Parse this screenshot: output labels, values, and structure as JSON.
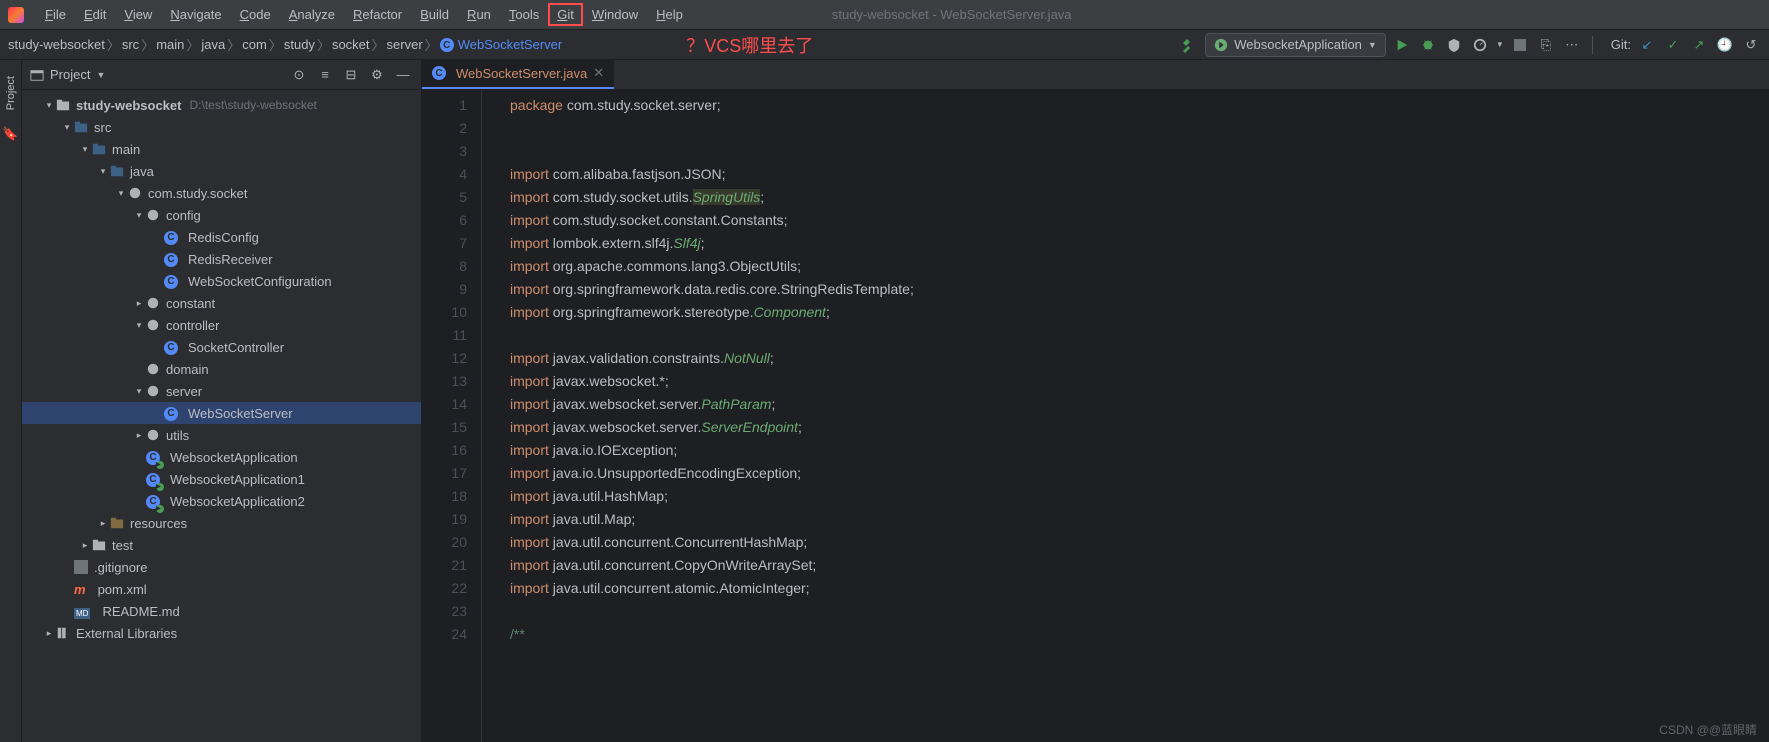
{
  "window": {
    "title": "study-websocket - WebSocketServer.java"
  },
  "menu": {
    "items": [
      "File",
      "Edit",
      "View",
      "Navigate",
      "Code",
      "Analyze",
      "Refactor",
      "Build",
      "Run",
      "Tools",
      "Git",
      "Window",
      "Help"
    ],
    "highlighted_index": 10
  },
  "annotation": "？VCS哪里去了",
  "breadcrumb": {
    "segments": [
      "study-websocket",
      "src",
      "main",
      "java",
      "com",
      "study",
      "socket",
      "server"
    ],
    "current_class": "WebSocketServer"
  },
  "run_config": {
    "name": "WebsocketApplication"
  },
  "git_label": "Git:",
  "project_panel": {
    "title": "Project",
    "root": {
      "label": "study-websocket",
      "path": "D:\\test\\study-websocket"
    },
    "tree": [
      {
        "depth": 0,
        "arrow": "▾",
        "icon": "project",
        "label": "study-websocket",
        "bold": true,
        "path": "D:\\test\\study-websocket"
      },
      {
        "depth": 1,
        "arrow": "▾",
        "icon": "folder-src",
        "label": "src"
      },
      {
        "depth": 2,
        "arrow": "▾",
        "icon": "folder-src",
        "label": "main"
      },
      {
        "depth": 3,
        "arrow": "▾",
        "icon": "folder-src",
        "label": "java"
      },
      {
        "depth": 4,
        "arrow": "▾",
        "icon": "package",
        "label": "com.study.socket"
      },
      {
        "depth": 5,
        "arrow": "▾",
        "icon": "package",
        "label": "config"
      },
      {
        "depth": 6,
        "arrow": "",
        "icon": "class",
        "label": "RedisConfig"
      },
      {
        "depth": 6,
        "arrow": "",
        "icon": "class",
        "label": "RedisReceiver"
      },
      {
        "depth": 6,
        "arrow": "",
        "icon": "class",
        "label": "WebSocketConfiguration"
      },
      {
        "depth": 5,
        "arrow": "▸",
        "icon": "package",
        "label": "constant"
      },
      {
        "depth": 5,
        "arrow": "▾",
        "icon": "package",
        "label": "controller"
      },
      {
        "depth": 6,
        "arrow": "",
        "icon": "class",
        "label": "SocketController"
      },
      {
        "depth": 5,
        "arrow": "",
        "icon": "package",
        "label": "domain"
      },
      {
        "depth": 5,
        "arrow": "▾",
        "icon": "package",
        "label": "server"
      },
      {
        "depth": 6,
        "arrow": "",
        "icon": "class",
        "label": "WebSocketServer",
        "selected": true
      },
      {
        "depth": 5,
        "arrow": "▸",
        "icon": "package",
        "label": "utils"
      },
      {
        "depth": 5,
        "arrow": "",
        "icon": "run-class",
        "label": "WebsocketApplication"
      },
      {
        "depth": 5,
        "arrow": "",
        "icon": "run-class",
        "label": "WebsocketApplication1"
      },
      {
        "depth": 5,
        "arrow": "",
        "icon": "run-class",
        "label": "WebsocketApplication2"
      },
      {
        "depth": 3,
        "arrow": "▸",
        "icon": "folder-res",
        "label": "resources"
      },
      {
        "depth": 2,
        "arrow": "▸",
        "icon": "folder",
        "label": "test"
      },
      {
        "depth": 1,
        "arrow": "",
        "icon": "gitignore",
        "label": ".gitignore"
      },
      {
        "depth": 1,
        "arrow": "",
        "icon": "maven",
        "label": "pom.xml"
      },
      {
        "depth": 1,
        "arrow": "",
        "icon": "md",
        "label": "README.md"
      },
      {
        "depth": 0,
        "arrow": "▸",
        "icon": "lib",
        "label": "External Libraries"
      }
    ]
  },
  "editor": {
    "tab_label": "WebSocketServer.java",
    "lines": [
      {
        "n": 1,
        "html": "<span class='kw'>package</span> <span class='pkg'>com.study.socket.server;</span>"
      },
      {
        "n": 2,
        "html": ""
      },
      {
        "n": 3,
        "html": ""
      },
      {
        "n": 4,
        "html": "<span class='kw'>import</span> <span class='pkg'>com.alibaba.fastjson.JSON;</span>"
      },
      {
        "n": 5,
        "html": "<span class='kw'>import</span> <span class='pkg'>com.study.socket.utils.</span><span class='cls slf4j-bg'>SpringUtils</span><span class='pkg'>;</span>"
      },
      {
        "n": 6,
        "html": "<span class='kw'>import</span> <span class='pkg'>com.study.socket.constant.Constants;</span>"
      },
      {
        "n": 7,
        "html": "<span class='kw'>import</span> <span class='pkg'>lombok.extern.slf4j.</span><span class='cls'>Slf4j</span><span class='pkg'>;</span>"
      },
      {
        "n": 8,
        "html": "<span class='kw'>import</span> <span class='pkg'>org.apache.commons.lang3.ObjectUtils;</span>"
      },
      {
        "n": 9,
        "html": "<span class='kw'>import</span> <span class='pkg'>org.springframework.data.redis.core.StringRedisTemplate;</span>"
      },
      {
        "n": 10,
        "html": "<span class='kw'>import</span> <span class='pkg'>org.springframework.stereotype.</span><span class='cls'>Component</span><span class='pkg'>;</span>"
      },
      {
        "n": 11,
        "html": ""
      },
      {
        "n": 12,
        "html": "<span class='kw'>import</span> <span class='pkg'>javax.validation.constraints.</span><span class='cls'>NotNull</span><span class='pkg'>;</span>"
      },
      {
        "n": 13,
        "html": "<span class='kw'>import</span> <span class='pkg'>javax.websocket.*;</span>"
      },
      {
        "n": 14,
        "html": "<span class='kw'>import</span> <span class='pkg'>javax.websocket.server.</span><span class='cls'>PathParam</span><span class='pkg'>;</span>"
      },
      {
        "n": 15,
        "html": "<span class='kw'>import</span> <span class='pkg'>javax.websocket.server.</span><span class='cls'>ServerEndpoint</span><span class='pkg'>;</span>"
      },
      {
        "n": 16,
        "html": "<span class='kw'>import</span> <span class='pkg'>java.io.IOException;</span>"
      },
      {
        "n": 17,
        "html": "<span class='kw'>import</span> <span class='pkg'>java.io.UnsupportedEncodingException;</span>"
      },
      {
        "n": 18,
        "html": "<span class='kw'>import</span> <span class='pkg'>java.util.HashMap;</span>"
      },
      {
        "n": 19,
        "html": "<span class='kw'>import</span> <span class='pkg'>java.util.Map;</span>"
      },
      {
        "n": 20,
        "html": "<span class='kw'>import</span> <span class='pkg'>java.util.concurrent.ConcurrentHashMap;</span>"
      },
      {
        "n": 21,
        "html": "<span class='kw'>import</span> <span class='pkg'>java.util.concurrent.CopyOnWriteArraySet;</span>"
      },
      {
        "n": 22,
        "html": "<span class='kw'>import</span> <span class='pkg'>java.util.concurrent.atomic.AtomicInteger;</span>"
      },
      {
        "n": 23,
        "html": ""
      },
      {
        "n": 24,
        "html": "<span class='note-green'>/**</span>"
      }
    ]
  },
  "watermark": "CSDN @@蓝眼睛"
}
